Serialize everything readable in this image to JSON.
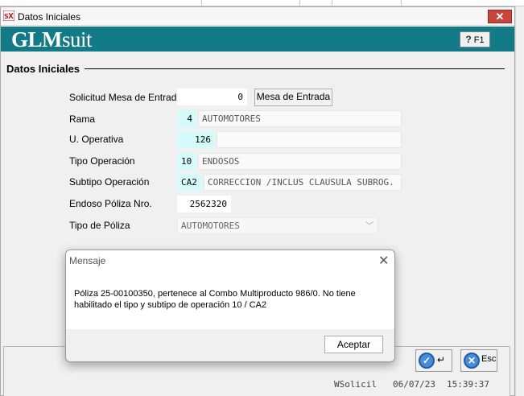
{
  "window": {
    "title": "Datos Iniciales",
    "close_label": "✕",
    "logo_bold": "GLM",
    "logo_rest": "suit",
    "help_label": "F1",
    "help_q": "?"
  },
  "section": {
    "title": "Datos Iniciales"
  },
  "form": {
    "solicitud": {
      "label": "Solicitud Mesa de Entrada",
      "value": "0",
      "button": "Mesa de Entrada"
    },
    "rama": {
      "label": "Rama",
      "code": "4",
      "desc": "AUTOMOTORES"
    },
    "u_operativa": {
      "label": "U. Operativa",
      "code": "126",
      "desc": ""
    },
    "tipo_operacion": {
      "label": "Tipo Operación",
      "code": "10",
      "desc": "ENDOSOS"
    },
    "subtipo_operacion": {
      "label": "Subtipo Operación",
      "code": "CA2",
      "desc": "CORRECCION /INCLUS CLAUSULA SUBROG."
    },
    "endoso_poliza": {
      "label": "Endoso Póliza Nro.",
      "value": "2562320"
    },
    "tipo_poliza": {
      "label": "Tipo de Póliza",
      "value": "AUTOMOTORES"
    }
  },
  "footer": {
    "ok_glyph": "↵",
    "esc_label": "Esc",
    "status_user": "WSolicil",
    "status_date": "06/07/23",
    "status_time": "15:39:37"
  },
  "dialog": {
    "title": "Mensaje",
    "close": "✕",
    "message_line1": "Póliza 25-00100350, pertenece al Combo Multiproducto 986/0. No tiene",
    "message_line2": "habilitado el tipo y subtipo de operación 10 / CA2",
    "ok_label": "Aceptar"
  },
  "colors": {
    "banner": "#137b88",
    "close_red": "#c8463c",
    "code_cyan": "#d5fafa"
  }
}
